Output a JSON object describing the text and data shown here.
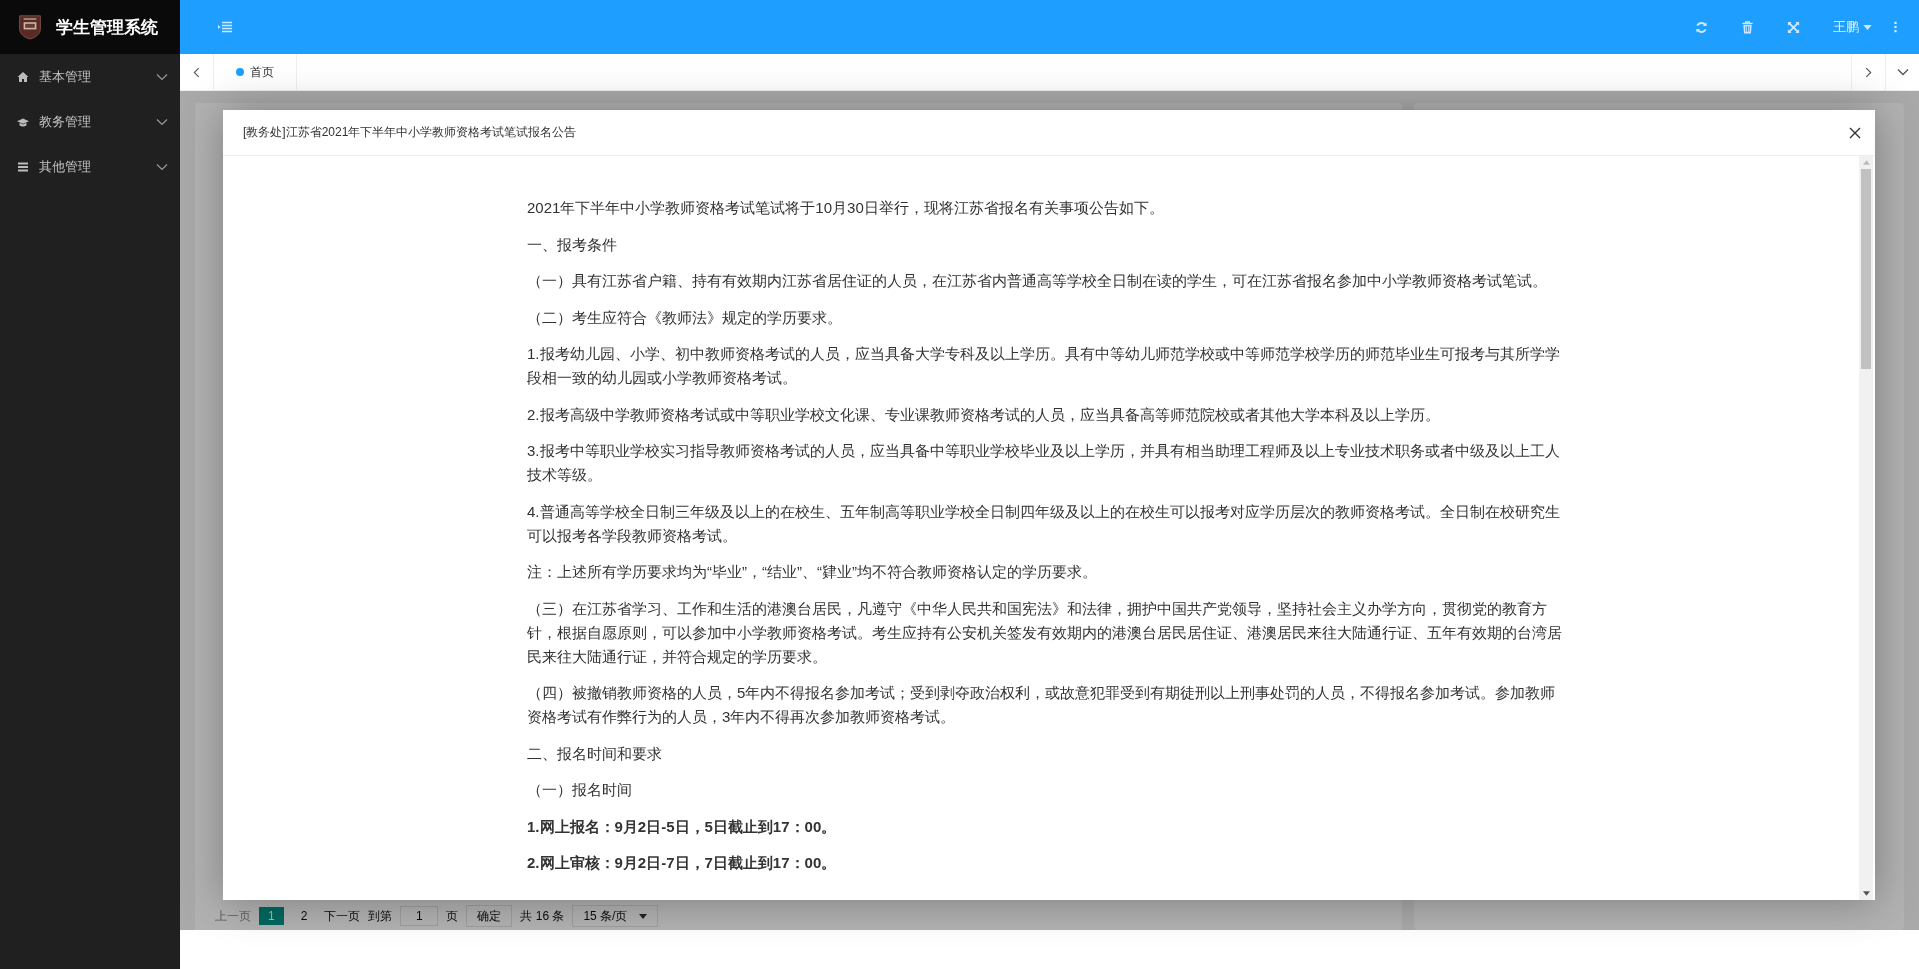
{
  "sidebar": {
    "title": "学生管理系统",
    "items": [
      {
        "label": "基本管理"
      },
      {
        "label": "教务管理"
      },
      {
        "label": "其他管理"
      }
    ]
  },
  "header": {
    "user": "王鹏"
  },
  "tabs": [
    {
      "label": "首页",
      "selected": true
    }
  ],
  "pagination": {
    "prev": {
      "label": "上一页",
      "disabled": true
    },
    "pages": [
      {
        "label": "1",
        "selected": true
      },
      {
        "label": "2",
        "selected": false
      }
    ],
    "next": "下一页",
    "goto_label": "到第",
    "goto_value": "1",
    "page_unit": "页",
    "confirm": "确定",
    "total": "共 16 条",
    "page_size": "15 条/页"
  },
  "modal": {
    "title": "[教务处]江苏省2021年下半年中小学教师资格考试笔试报名公告",
    "paragraphs": [
      {
        "kind": "normal",
        "text": "2021年下半年中小学教师资格考试笔试将于10月30日举行，现将江苏省报名有关事项公告如下。"
      },
      {
        "kind": "normal",
        "text": "一、报考条件"
      },
      {
        "kind": "normal",
        "text": "（一）具有江苏省户籍、持有有效期内江苏省居住证的人员，在江苏省内普通高等学校全日制在读的学生，可在江苏省报名参加中小学教师资格考试笔试。"
      },
      {
        "kind": "normal",
        "text": "（二）考生应符合《教师法》规定的学历要求。"
      },
      {
        "kind": "normal",
        "text": "1.报考幼儿园、小学、初中教师资格考试的人员，应当具备大学专科及以上学历。具有中等幼儿师范学校或中等师范学校学历的师范毕业生可报考与其所学学段相一致的幼儿园或小学教师资格考试。"
      },
      {
        "kind": "normal",
        "text": "2.报考高级中学教师资格考试或中等职业学校文化课、专业课教师资格考试的人员，应当具备高等师范院校或者其他大学本科及以上学历。"
      },
      {
        "kind": "normal",
        "text": "3.报考中等职业学校实习指导教师资格考试的人员，应当具备中等职业学校毕业及以上学历，并具有相当助理工程师及以上专业技术职务或者中级及以上工人技术等级。"
      },
      {
        "kind": "normal",
        "text": "4.普通高等学校全日制三年级及以上的在校生、五年制高等职业学校全日制四年级及以上的在校生可以报考对应学历层次的教师资格考试。全日制在校研究生可以报考各学段教师资格考试。"
      },
      {
        "kind": "normal",
        "text": "注：上述所有学历要求均为“毕业”，“结业”、“肄业”均不符合教师资格认定的学历要求。"
      },
      {
        "kind": "normal",
        "text": "（三）在江苏省学习、工作和生活的港澳台居民，凡遵守《中华人民共和国宪法》和法律，拥护中国共产党领导，坚持社会主义办学方向，贯彻党的教育方针，根据自愿原则，可以参加中小学教师资格考试。考生应持有公安机关签发有效期内的港澳台居民居住证、港澳居民来往大陆通行证、五年有效期的台湾居民来往大陆通行证，并符合规定的学历要求。"
      },
      {
        "kind": "normal",
        "text": "（四）被撤销教师资格的人员，5年内不得报名参加考试；受到剥夺政治权利，或故意犯罪受到有期徒刑以上刑事处罚的人员，不得报名参加考试。参加教师资格考试有作弊行为的人员，3年内不得再次参加教师资格考试。"
      },
      {
        "kind": "normal",
        "text": "二、报名时间和要求"
      },
      {
        "kind": "normal",
        "text": "（一）报名时间"
      },
      {
        "kind": "strong",
        "text": "1.网上报名：9月2日-5日，5日截止到17：00。"
      },
      {
        "kind": "strong",
        "text": "2.网上审核：9月2日-7日，7日截止到17：00。"
      }
    ]
  }
}
